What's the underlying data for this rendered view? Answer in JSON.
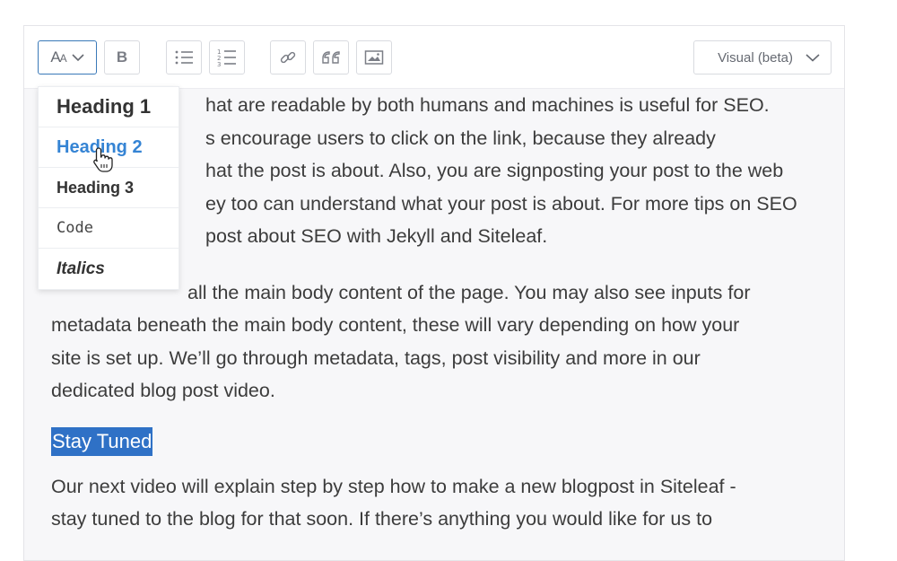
{
  "toolbar": {
    "format_label_big": "A",
    "format_label_small": "A",
    "bold_label": "B",
    "mode_label": "Visual (beta)"
  },
  "format_menu": {
    "items": [
      {
        "label": "Heading 1"
      },
      {
        "label": "Heading 2"
      },
      {
        "label": "Heading 3"
      },
      {
        "label": "Code"
      },
      {
        "label": "Italics"
      }
    ]
  },
  "content": {
    "para1": [
      "hat are readable by both humans and machines is useful for SEO.",
      "s encourage users to click on the link, because they already",
      "hat the post is about. Also, you are signposting your post to the web",
      "ey too can understand what your post is about. For more tips on SEO",
      "post about SEO with Jekyll and Siteleaf."
    ],
    "para2": [
      "all the main body content of the page. You may also see inputs for",
      "metadata beneath the main body content, these will vary depending on how your",
      "site is set up. We’ll go through metadata, tags, post visibility and more in our",
      "dedicated blog post video."
    ],
    "heading": "Stay Tuned",
    "para3": [
      "Our next video will explain step by step how to make a new blogpost in Siteleaf -",
      "stay tuned to the blog for that soon. If there’s anything you would like for us to"
    ]
  },
  "colors": {
    "accent": "#2f71c6",
    "menu_active": "#3584d4"
  }
}
